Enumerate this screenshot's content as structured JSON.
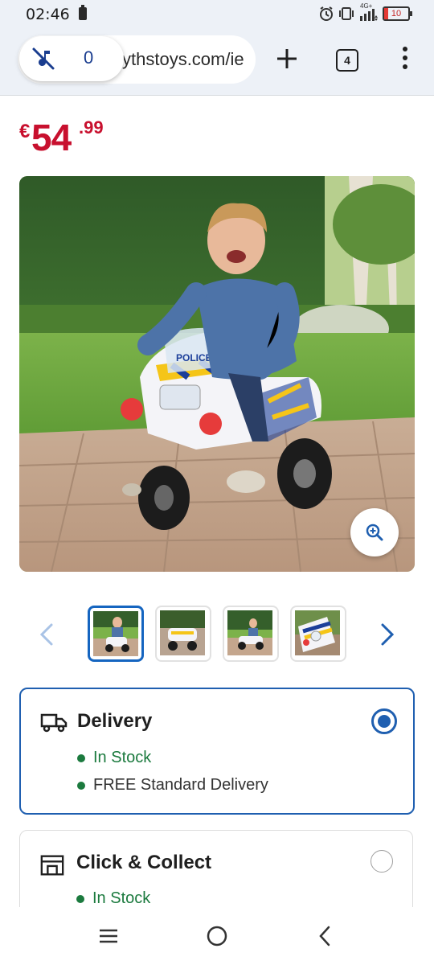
{
  "status_bar": {
    "time": "02:46",
    "network": "4G+",
    "battery": "10"
  },
  "browser": {
    "url": "ythstoys.com/ie",
    "media_count": "0",
    "tab_count": "4"
  },
  "product": {
    "price_currency": "€",
    "price_main": "54",
    "price_decimal": ".99",
    "image_label": "POLICE"
  },
  "gallery": {
    "thumbnail_count": 4,
    "active_index": 0
  },
  "fulfilment": {
    "delivery": {
      "title": "Delivery",
      "selected": true,
      "stock_status": "In Stock",
      "note": "FREE Standard Delivery"
    },
    "click_collect": {
      "title": "Click & Collect",
      "selected": false,
      "stock_status": "In Stock"
    }
  },
  "colors": {
    "price": "#c8102e",
    "accent": "#1f5fb0",
    "in_stock": "#1b7a3e"
  }
}
